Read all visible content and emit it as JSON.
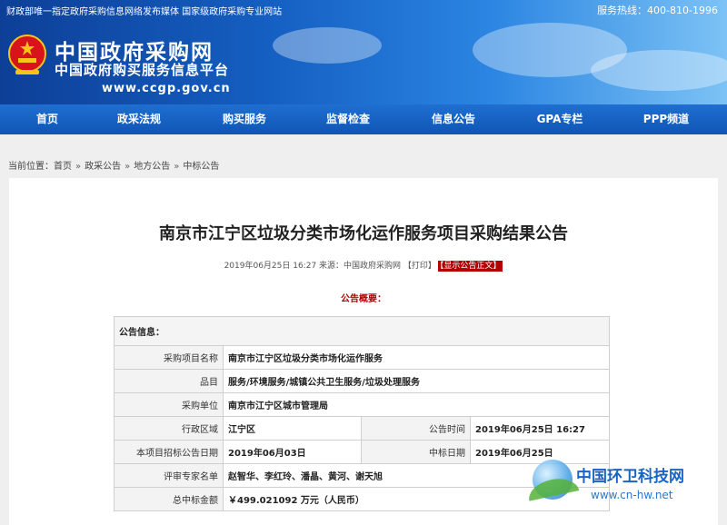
{
  "header": {
    "slogan": "财政部唯一指定政府采购信息网络发布媒体 国家级政府采购专业网站",
    "hotline": "服务热线：400-810-1996",
    "logo_title": "中国政府采购网",
    "logo_subtitle": "中国政府购买服务信息平台",
    "logo_url": "www.ccgp.gov.cn"
  },
  "nav": {
    "items": [
      {
        "label": "首页"
      },
      {
        "label": "政采法规"
      },
      {
        "label": "购买服务"
      },
      {
        "label": "监督检查"
      },
      {
        "label": "信息公告"
      },
      {
        "label": "GPA专栏"
      },
      {
        "label": "PPP频道"
      }
    ]
  },
  "breadcrumb": {
    "prefix": "当前位置：",
    "items": [
      "首页",
      "政采公告",
      "地方公告",
      "中标公告"
    ],
    "separator": "»"
  },
  "article": {
    "title": "南京市江宁区垃圾分类市场化运作服务项目采购结果公告",
    "meta": "2019年06月25日 16:27 来源：中国政府采购网 【打印】",
    "show_button": "【显示公告正文】",
    "summary_heading": "公告概要："
  },
  "table": {
    "section_title": "公告信息：",
    "rows": [
      {
        "label": "采购项目名称",
        "value": "南京市江宁区垃圾分类市场化运作服务"
      },
      {
        "label": "品目",
        "value": "服务/环境服务/城镇公共卫生服务/垃圾处理服务"
      },
      {
        "label": "采购单位",
        "value": "南京市江宁区城市管理局"
      },
      {
        "label": "行政区域",
        "value": "江宁区",
        "label2": "公告时间",
        "value2": "2019年06月25日 16:27"
      },
      {
        "label": "本项目招标公告日期",
        "value": "2019年06月03日",
        "label2": "中标日期",
        "value2": "2019年06月25日"
      },
      {
        "label": "评审专家名单",
        "value": "赵智华、李红玲、潘晶、黄河、谢天旭"
      },
      {
        "label": "总中标金额",
        "value": "￥499.021092 万元（人民币）"
      }
    ]
  },
  "watermark": {
    "title": "中国环卫科技网",
    "url": "www.cn-hw.net"
  },
  "colors": {
    "header_blue": "#1560c3",
    "nav_blue": "#1f6fd0",
    "accent_red": "#b40000"
  }
}
